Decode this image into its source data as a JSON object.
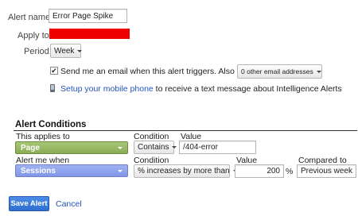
{
  "form": {
    "alert_name_label": "Alert name:",
    "alert_name_value": "Error Page Spike",
    "apply_to_label": "Apply to:",
    "apply_to_redacted_color": "#ee0000",
    "period_label": "Period:",
    "period_value": "Week",
    "email_checkbox_checked": true,
    "email_text": "Send me an email when this alert triggers. Also include",
    "email_dropdown_value": "0 other email addresses",
    "mobile_link_text": "Setup your mobile phone",
    "mobile_text_rest": "to receive a text message about Intelligence Alerts"
  },
  "conditions": {
    "section_title": "Alert Conditions",
    "row1": {
      "heading": "This applies to",
      "dimension": "Page",
      "condition_header": "Condition",
      "condition": "Contains",
      "value_header": "Value",
      "value": "/404-error"
    },
    "row2": {
      "heading": "Alert me when",
      "metric": "Sessions",
      "condition_header": "Condition",
      "condition": "% increases by more than",
      "value_header": "Value",
      "value": "200",
      "unit": "%",
      "compared_header": "Compared to",
      "compared": "Previous week"
    }
  },
  "actions": {
    "save_label": "Save Alert",
    "cancel_label": "Cancel"
  },
  "colors": {
    "dimension_green": "#8aac56",
    "metric_blue": "#8097e8",
    "primary_button": "#2f6ecf",
    "link": "#2255bb"
  }
}
